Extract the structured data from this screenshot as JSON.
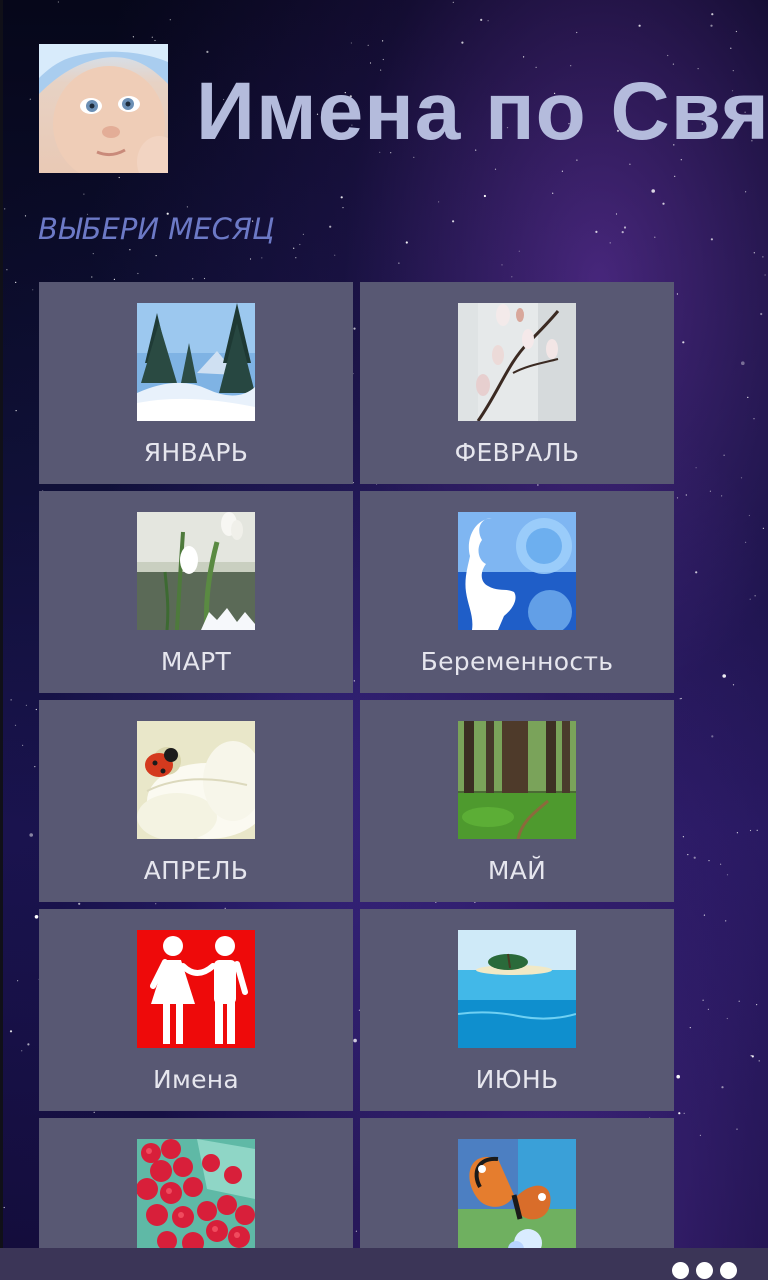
{
  "header": {
    "title": "Имена по Святцам",
    "subtitle": "ВЫБЕРИ МЕСЯЦ"
  },
  "tiles": [
    {
      "label": "ЯНВАРЬ",
      "icon": "winter-forest-image"
    },
    {
      "label": "ФЕВРАЛЬ",
      "icon": "willow-branch-image"
    },
    {
      "label": "МАРТ",
      "icon": "snowdrop-image"
    },
    {
      "label": "Беременность",
      "icon": "pregnant-silhouette-image"
    },
    {
      "label": "АПРЕЛЬ",
      "icon": "ladybug-flower-image"
    },
    {
      "label": "МАЙ",
      "icon": "green-forest-image"
    },
    {
      "label": "Имена",
      "icon": "couple-sign-image"
    },
    {
      "label": "ИЮНЬ",
      "icon": "tropical-island-image"
    },
    {
      "label": "",
      "icon": "raspberries-image"
    },
    {
      "label": "",
      "icon": "butterfly-image"
    }
  ],
  "app_bar": {
    "more_icon": "ellipsis-icon"
  },
  "colors": {
    "tile_bg": "#585873",
    "title": "#b4bbdc",
    "subtitle": "#6c79c6",
    "app_bar": "#3b3557"
  }
}
